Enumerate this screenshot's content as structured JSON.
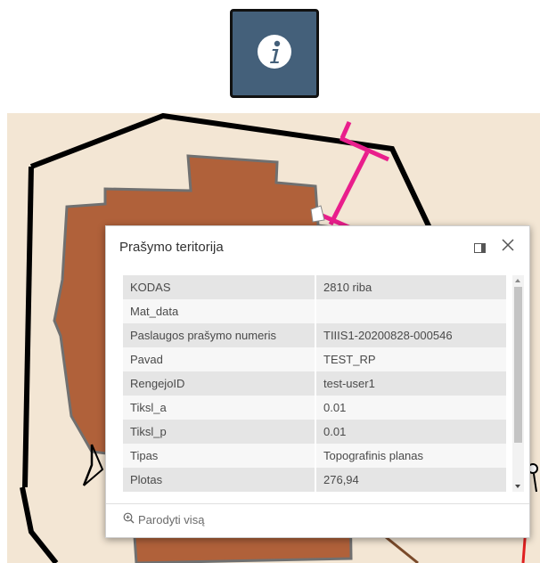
{
  "toolbar": {
    "info_icon": "info-icon"
  },
  "popup": {
    "title": "Prašymo teritorija",
    "maximize_icon": "maximize-icon",
    "close_icon": "close-icon",
    "attributes": [
      {
        "key": "KODAS",
        "value": "2810 riba"
      },
      {
        "key": "Mat_data",
        "value": ""
      },
      {
        "key": "Paslaugos prašymo numeris",
        "value": "TIIIS1-20200828-000546"
      },
      {
        "key": "Pavad",
        "value": "TEST_RP"
      },
      {
        "key": "RengejoID",
        "value": "test-user1"
      },
      {
        "key": "Tiksl_a",
        "value": "0.01"
      },
      {
        "key": "Tiksl_p",
        "value": "0.01"
      },
      {
        "key": "Tipas",
        "value": "Topografinis planas"
      },
      {
        "key": "Plotas",
        "value": "276,94"
      }
    ],
    "show_all_label": "Parodyti visą",
    "zoom_icon": "zoom-in-icon"
  },
  "colors": {
    "button_bg": "#44607a",
    "building_fill": "#b0613a",
    "building_stroke": "#6e6e6e",
    "map_bg": "#f3e6d4",
    "boundary": "#000000",
    "magenta_line": "#e91e8c",
    "red_line": "#e02020"
  }
}
